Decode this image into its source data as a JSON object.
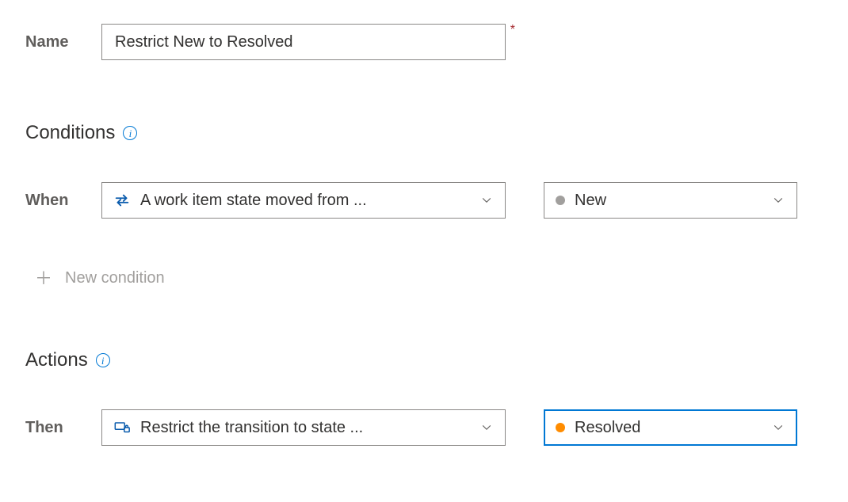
{
  "labels": {
    "name": "Name",
    "when": "When",
    "then": "Then"
  },
  "name_value": "Restrict New to Resolved",
  "sections": {
    "conditions": "Conditions",
    "actions": "Actions"
  },
  "conditions": {
    "type_label": "A work item state moved from ...",
    "state_label": "New"
  },
  "actions": {
    "type_label": "Restrict the transition to state ...",
    "state_label": "Resolved"
  },
  "new_condition_label": "New condition",
  "required_star": "*",
  "info_glyph": "i"
}
